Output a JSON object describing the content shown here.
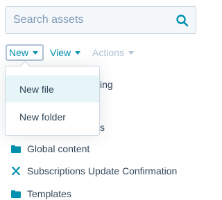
{
  "search": {
    "placeholder": "Search assets",
    "value": ""
  },
  "toolbar": {
    "new_label": "New",
    "view_label": "View",
    "actions_label": "Actions"
  },
  "new_menu": {
    "items": [
      {
        "label": "New file"
      },
      {
        "label": "New folder"
      }
    ]
  },
  "tree": {
    "items": [
      {
        "label_fragment": "ing",
        "type": "folder"
      },
      {
        "label_fragment": "s",
        "type": "folder"
      },
      {
        "label": "Global content",
        "type": "folder"
      },
      {
        "label": "Subscriptions Update Confirmation",
        "type": "file"
      },
      {
        "label": "Templates",
        "type": "folder"
      }
    ]
  },
  "colors": {
    "accent": "#0091ae",
    "text": "#33475b",
    "disabled": "#b0c1d4",
    "menu_hover": "#e5f5f8"
  },
  "icons": {
    "search": "search-icon",
    "folder": "folder-icon",
    "file": "x-file-icon",
    "caret": "caret-down-icon"
  }
}
